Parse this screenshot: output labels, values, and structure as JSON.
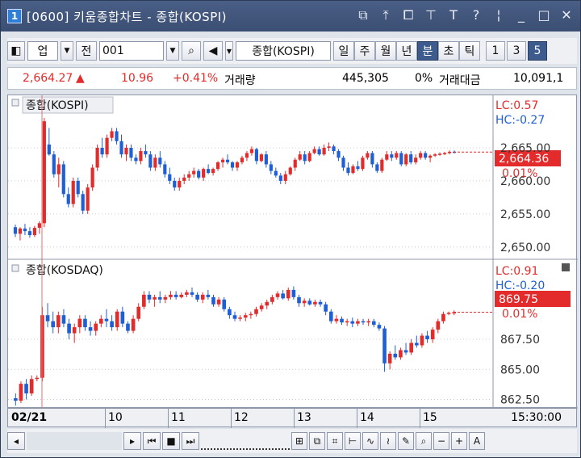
{
  "window": {
    "number": "1",
    "title": "[0600] 키움종합차트 - 종합(KOSPI)",
    "controls": [
      "restore-icon",
      "pin-icon",
      "copy-icon",
      "pin-down-icon",
      "T",
      "?",
      "|",
      "minimize-icon",
      "maximize-icon",
      "close-icon"
    ]
  },
  "toolbar": {
    "type_label": "업",
    "prev_label": "전",
    "code_value": "001",
    "search_icon": "search-icon",
    "speaker_icon": "speaker-icon",
    "index_name": "종합(KOSPI)",
    "period_buttons": [
      {
        "label": "일",
        "active": false
      },
      {
        "label": "주",
        "active": false
      },
      {
        "label": "월",
        "active": false
      },
      {
        "label": "년",
        "active": false
      },
      {
        "label": "분",
        "active": true
      },
      {
        "label": "초",
        "active": false
      },
      {
        "label": "틱",
        "active": false
      }
    ],
    "interval_buttons": [
      {
        "label": "1",
        "active": false
      },
      {
        "label": "3",
        "active": false
      },
      {
        "label": "5",
        "active": true
      }
    ]
  },
  "quote": {
    "price": "2,664.27",
    "arrow": "▲",
    "change": "10.96",
    "change_pct": "+0.41%",
    "volume_label": "거래량",
    "volume": "445,305",
    "vol_pct": "0%",
    "amount_label": "거래대금",
    "amount": "10,091,1"
  },
  "colors": {
    "up": "#e32b2b",
    "down": "#1f5fd6",
    "grid": "#c8ccd6",
    "vline": "#e07070"
  },
  "panels": {
    "kospi": {
      "label": "종합(KOSPI)",
      "lc": "LC:0.57",
      "hc": "HC:-0.27",
      "current_price": "2,664.36",
      "current_pct": "0.01%",
      "axis_labels": [
        "2,665.00",
        "2,660.00",
        "2,655.00",
        "2,650.00"
      ]
    },
    "kosdaq": {
      "label": "종합(KOSDAQ)",
      "lc": "LC:0.91",
      "hc": "HC:-0.20",
      "current_price": "869.75",
      "current_pct": "0.01%",
      "axis_labels": [
        "867.50",
        "865.00",
        "862.50"
      ]
    }
  },
  "time_axis": {
    "date_label": "02/21",
    "ticks": [
      "10",
      "11",
      "12",
      "13",
      "14",
      "15"
    ],
    "time_label": "15:30:00"
  },
  "chart_data": [
    {
      "type": "candlestick",
      "title": "종합(KOSPI)",
      "ylim": [
        2649,
        2670
      ],
      "candles": [
        [
          2653.0,
          2653.4,
          2651.5,
          2652.0
        ],
        [
          2652.0,
          2653.0,
          2651.0,
          2652.8
        ],
        [
          2652.8,
          2653.5,
          2651.8,
          2652.4
        ],
        [
          2652.4,
          2653.0,
          2651.4,
          2651.8
        ],
        [
          2651.8,
          2653.2,
          2651.5,
          2652.9
        ],
        [
          2652.9,
          2653.9,
          2652.0,
          2653.6
        ],
        [
          2653.6,
          2669.5,
          2653.0,
          2669.0
        ],
        [
          2665.5,
          2668.0,
          2663.8,
          2664.0
        ],
        [
          2664.0,
          2664.5,
          2660.5,
          2661.0
        ],
        [
          2661.0,
          2663.5,
          2659.0,
          2662.5
        ],
        [
          2662.5,
          2663.0,
          2657.5,
          2658.0
        ],
        [
          2658.0,
          2659.0,
          2656.0,
          2656.5
        ],
        [
          2656.5,
          2660.5,
          2656.0,
          2660.0
        ],
        [
          2660.0,
          2660.5,
          2657.5,
          2658.0
        ],
        [
          2658.0,
          2658.5,
          2655.0,
          2655.5
        ],
        [
          2655.5,
          2659.5,
          2655.0,
          2659.0
        ],
        [
          2659.0,
          2662.5,
          2658.5,
          2662.0
        ],
        [
          2662.0,
          2665.5,
          2661.5,
          2665.0
        ],
        [
          2665.0,
          2666.5,
          2663.5,
          2664.0
        ],
        [
          2664.0,
          2667.0,
          2663.5,
          2666.5
        ],
        [
          2666.5,
          2668.0,
          2666.0,
          2667.5
        ],
        [
          2667.5,
          2668.0,
          2665.5,
          2666.0
        ],
        [
          2666.0,
          2667.0,
          2663.5,
          2664.0
        ],
        [
          2664.0,
          2665.5,
          2663.0,
          2665.0
        ],
        [
          2665.0,
          2665.5,
          2663.0,
          2663.5
        ],
        [
          2663.5,
          2664.0,
          2662.5,
          2663.0
        ],
        [
          2663.0,
          2665.0,
          2662.5,
          2664.5
        ],
        [
          2664.5,
          2665.5,
          2663.5,
          2664.0
        ],
        [
          2664.0,
          2664.5,
          2661.5,
          2662.0
        ],
        [
          2662.0,
          2664.0,
          2661.5,
          2663.5
        ],
        [
          2663.5,
          2664.5,
          2662.0,
          2662.5
        ],
        [
          2662.5,
          2663.0,
          2660.5,
          2661.0
        ],
        [
          2661.0,
          2662.0,
          2659.5,
          2660.0
        ],
        [
          2660.0,
          2660.5,
          2658.5,
          2659.0
        ],
        [
          2659.0,
          2660.5,
          2658.5,
          2660.0
        ],
        [
          2660.0,
          2661.0,
          2659.5,
          2660.5
        ],
        [
          2660.5,
          2661.5,
          2660.0,
          2661.0
        ],
        [
          2661.0,
          2662.0,
          2660.5,
          2661.5
        ],
        [
          2661.5,
          2661.8,
          2660.2,
          2660.5
        ],
        [
          2660.5,
          2662.0,
          2660.0,
          2661.8
        ],
        [
          2661.8,
          2662.5,
          2661.0,
          2661.2
        ],
        [
          2661.2,
          2662.0,
          2660.8,
          2661.8
        ],
        [
          2661.8,
          2663.0,
          2661.5,
          2662.8
        ],
        [
          2662.8,
          2663.5,
          2662.0,
          2663.2
        ],
        [
          2663.2,
          2664.0,
          2662.5,
          2662.8
        ],
        [
          2662.8,
          2663.0,
          2661.5,
          2662.0
        ],
        [
          2662.0,
          2663.0,
          2661.5,
          2662.8
        ],
        [
          2662.8,
          2663.8,
          2662.5,
          2663.5
        ],
        [
          2663.5,
          2664.5,
          2663.0,
          2664.2
        ],
        [
          2664.2,
          2665.2,
          2663.8,
          2664.8
        ],
        [
          2664.8,
          2665.0,
          2662.5,
          2663.0
        ],
        [
          2663.0,
          2664.2,
          2662.8,
          2664.0
        ],
        [
          2664.0,
          2664.5,
          2662.0,
          2662.5
        ],
        [
          2662.5,
          2663.0,
          2661.0,
          2661.5
        ],
        [
          2661.5,
          2662.0,
          2660.5,
          2660.8
        ],
        [
          2660.8,
          2661.2,
          2659.5,
          2660.0
        ],
        [
          2660.0,
          2661.5,
          2659.5,
          2661.0
        ],
        [
          2661.0,
          2662.2,
          2660.8,
          2662.0
        ],
        [
          2662.0,
          2663.5,
          2661.5,
          2663.2
        ],
        [
          2663.2,
          2664.5,
          2663.0,
          2664.0
        ],
        [
          2664.0,
          2664.5,
          2662.5,
          2663.0
        ],
        [
          2663.0,
          2664.5,
          2662.8,
          2664.2
        ],
        [
          2664.2,
          2665.2,
          2664.0,
          2664.8
        ],
        [
          2664.8,
          2665.2,
          2663.8,
          2664.0
        ],
        [
          2664.0,
          2665.5,
          2663.8,
          2665.0
        ],
        [
          2665.0,
          2665.8,
          2664.5,
          2665.2
        ],
        [
          2665.2,
          2665.5,
          2664.0,
          2664.5
        ],
        [
          2664.5,
          2664.8,
          2663.0,
          2663.5
        ],
        [
          2663.5,
          2663.8,
          2661.5,
          2662.0
        ],
        [
          2662.0,
          2662.8,
          2660.8,
          2661.2
        ],
        [
          2661.2,
          2662.5,
          2661.0,
          2662.2
        ],
        [
          2662.2,
          2663.0,
          2661.5,
          2661.8
        ],
        [
          2661.8,
          2663.8,
          2661.5,
          2663.5
        ],
        [
          2663.5,
          2664.5,
          2663.2,
          2664.2
        ],
        [
          2664.2,
          2664.5,
          2662.0,
          2662.5
        ],
        [
          2662.5,
          2662.8,
          2661.2,
          2661.5
        ],
        [
          2661.5,
          2663.5,
          2661.2,
          2663.2
        ],
        [
          2663.2,
          2664.5,
          2663.0,
          2664.0
        ],
        [
          2664.0,
          2664.5,
          2663.0,
          2663.5
        ],
        [
          2663.5,
          2664.5,
          2663.2,
          2664.2
        ],
        [
          2664.2,
          2664.5,
          2662.2,
          2662.5
        ],
        [
          2662.5,
          2664.2,
          2662.2,
          2664.0
        ],
        [
          2664.0,
          2664.5,
          2662.5,
          2662.8
        ],
        [
          2662.8,
          2664.0,
          2662.5,
          2663.5
        ],
        [
          2663.5,
          2664.5,
          2663.2,
          2664.2
        ],
        [
          2664.2,
          2664.5,
          2663.2,
          2663.5
        ],
        [
          2663.5,
          2664.0,
          2662.8,
          2663.8
        ],
        [
          2663.8,
          2664.2,
          2663.6,
          2664.0
        ],
        [
          2664.0,
          2664.3,
          2663.8,
          2664.1
        ],
        [
          2664.1,
          2664.4,
          2663.9,
          2664.2
        ],
        [
          2664.2,
          2664.6,
          2664.0,
          2664.4
        ],
        [
          2664.4,
          2664.6,
          2664.2,
          2664.36
        ]
      ]
    },
    {
      "type": "candlestick",
      "title": "종합(KOSDAQ)",
      "ylim": [
        862,
        872.6
      ],
      "candles": [
        [
          862.6,
          863.0,
          862.0,
          862.4
        ],
        [
          862.4,
          864.0,
          862.2,
          863.8
        ],
        [
          863.8,
          864.2,
          862.5,
          863.0
        ],
        [
          863.0,
          864.5,
          862.8,
          864.2
        ],
        [
          864.2,
          864.5,
          864.0,
          864.3
        ],
        [
          864.3,
          870.2,
          864.0,
          869.5
        ],
        [
          869.5,
          870.5,
          868.5,
          869.0
        ],
        [
          869.0,
          869.8,
          868.0,
          868.5
        ],
        [
          868.5,
          869.8,
          868.0,
          869.5
        ],
        [
          869.5,
          870.0,
          868.5,
          868.8
        ],
        [
          868.8,
          869.2,
          867.5,
          868.0
        ],
        [
          868.0,
          868.8,
          867.2,
          868.5
        ],
        [
          868.5,
          869.5,
          868.0,
          869.2
        ],
        [
          869.2,
          869.5,
          868.2,
          868.5
        ],
        [
          868.5,
          869.0,
          867.8,
          868.2
        ],
        [
          868.2,
          869.0,
          867.8,
          868.8
        ],
        [
          868.8,
          869.5,
          868.5,
          869.2
        ],
        [
          869.2,
          870.0,
          868.5,
          869.0
        ],
        [
          869.0,
          869.5,
          868.2,
          868.5
        ],
        [
          868.5,
          870.0,
          868.2,
          869.8
        ],
        [
          869.8,
          870.2,
          868.5,
          868.8
        ],
        [
          868.8,
          869.0,
          868.0,
          868.2
        ],
        [
          868.2,
          869.5,
          868.0,
          869.2
        ],
        [
          869.2,
          870.5,
          869.0,
          870.2
        ],
        [
          870.2,
          871.5,
          870.0,
          871.2
        ],
        [
          871.2,
          871.5,
          870.5,
          870.8
        ],
        [
          870.8,
          871.2,
          870.2,
          871.0
        ],
        [
          871.0,
          871.5,
          870.5,
          870.8
        ],
        [
          870.8,
          871.2,
          870.5,
          871.0
        ],
        [
          871.0,
          871.5,
          870.8,
          871.2
        ],
        [
          871.2,
          871.5,
          870.8,
          871.0
        ],
        [
          871.0,
          871.4,
          870.9,
          871.2
        ],
        [
          871.2,
          871.6,
          871.0,
          871.4
        ],
        [
          871.4,
          871.8,
          871.0,
          871.2
        ],
        [
          871.2,
          871.4,
          870.6,
          870.8
        ],
        [
          870.8,
          871.4,
          870.5,
          871.2
        ],
        [
          871.2,
          871.6,
          870.8,
          871.0
        ],
        [
          871.0,
          871.2,
          870.2,
          870.4
        ],
        [
          870.4,
          871.0,
          870.2,
          870.8
        ],
        [
          870.8,
          871.0,
          869.8,
          870.0
        ],
        [
          870.0,
          870.2,
          869.2,
          869.5
        ],
        [
          869.5,
          869.8,
          869.0,
          869.2
        ],
        [
          869.2,
          869.5,
          869.0,
          869.3
        ],
        [
          869.3,
          869.7,
          869.0,
          869.5
        ],
        [
          869.5,
          869.8,
          869.2,
          869.6
        ],
        [
          869.6,
          870.2,
          869.4,
          870.0
        ],
        [
          870.0,
          870.5,
          869.8,
          870.3
        ],
        [
          870.3,
          870.8,
          870.0,
          870.6
        ],
        [
          870.6,
          871.2,
          870.4,
          871.0
        ],
        [
          871.0,
          871.5,
          870.8,
          871.3
        ],
        [
          871.3,
          871.6,
          870.8,
          870.9
        ],
        [
          870.9,
          871.8,
          870.7,
          871.6
        ],
        [
          871.6,
          871.9,
          870.8,
          871.0
        ],
        [
          871.0,
          871.2,
          870.2,
          870.5
        ],
        [
          870.5,
          870.9,
          870.2,
          870.7
        ],
        [
          870.7,
          870.9,
          870.3,
          870.4
        ],
        [
          870.4,
          870.8,
          870.2,
          870.6
        ],
        [
          870.6,
          870.8,
          870.2,
          870.4
        ],
        [
          870.4,
          870.6,
          869.5,
          869.8
        ],
        [
          869.8,
          870.0,
          868.8,
          869.0
        ],
        [
          869.0,
          869.5,
          868.8,
          869.2
        ],
        [
          869.2,
          869.4,
          868.7,
          868.9
        ],
        [
          868.9,
          869.2,
          868.6,
          869.0
        ],
        [
          869.0,
          869.3,
          868.5,
          868.8
        ],
        [
          868.8,
          869.2,
          868.6,
          869.0
        ],
        [
          869.0,
          869.2,
          868.7,
          868.9
        ],
        [
          868.9,
          869.2,
          868.6,
          869.0
        ],
        [
          869.0,
          869.2,
          868.5,
          868.7
        ],
        [
          868.7,
          868.9,
          868.2,
          868.4
        ],
        [
          868.4,
          868.6,
          864.8,
          865.5
        ],
        [
          865.5,
          866.5,
          865.0,
          866.3
        ],
        [
          866.3,
          867.0,
          865.8,
          866.0
        ],
        [
          866.0,
          866.8,
          865.8,
          866.6
        ],
        [
          866.6,
          867.2,
          866.2,
          866.4
        ],
        [
          866.4,
          867.5,
          866.2,
          867.2
        ],
        [
          867.2,
          867.8,
          866.8,
          867.0
        ],
        [
          867.0,
          868.0,
          866.8,
          867.8
        ],
        [
          867.8,
          868.2,
          867.2,
          867.5
        ],
        [
          867.5,
          868.5,
          867.2,
          868.3
        ],
        [
          868.3,
          869.2,
          868.0,
          869.0
        ],
        [
          869.0,
          869.8,
          868.8,
          869.6
        ],
        [
          869.6,
          869.8,
          869.5,
          869.7
        ],
        [
          869.7,
          869.9,
          869.5,
          869.75
        ]
      ]
    }
  ]
}
